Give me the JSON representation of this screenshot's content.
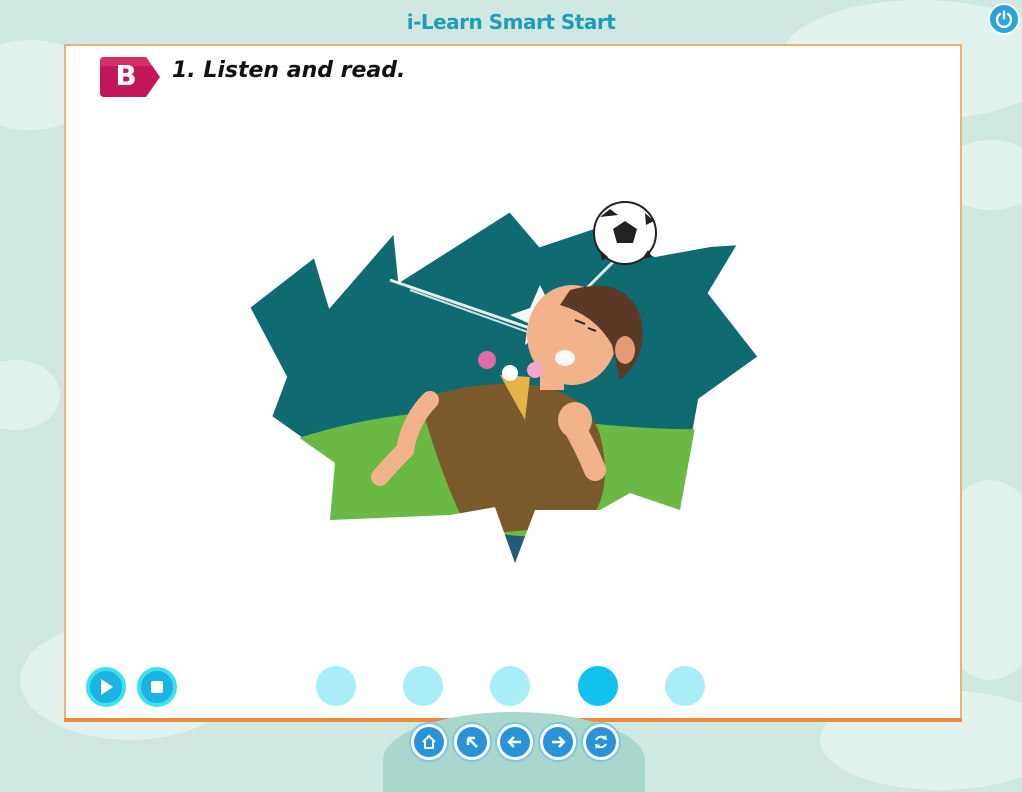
{
  "app": {
    "title": "i-Learn Smart Start"
  },
  "lesson": {
    "section_letter": "B",
    "instruction": "1. Listen and read."
  },
  "icons": {
    "power": "power-icon",
    "play": "play-icon",
    "stop": "stop-icon",
    "home": "home-icon",
    "back": "arrow-up-left-icon",
    "prev": "arrow-left-icon",
    "next": "arrow-right-icon",
    "refresh": "refresh-icon"
  },
  "pagination": {
    "count": 5,
    "active_index": 3
  },
  "colors": {
    "accent": "#1ab3e2",
    "badge": "#c2185b",
    "panel_border": "#f08a3a",
    "dot_inactive": "#a9eef6",
    "dot_active": "#12c2ee"
  }
}
